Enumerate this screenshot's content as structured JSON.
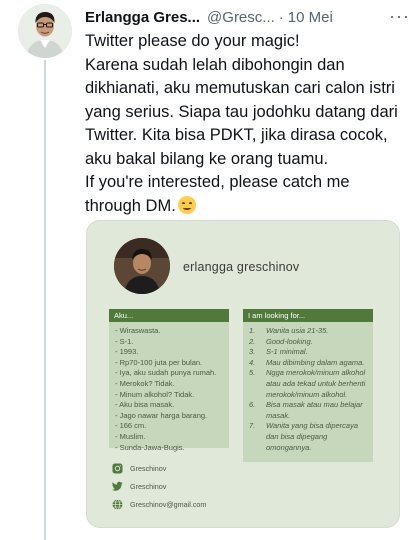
{
  "tweet": {
    "author_name": "Erlangga Gres...",
    "handle": "@Gresc...",
    "separator": "·",
    "time": "10 Mei",
    "more_icon": "more-icon",
    "text_lines": [
      "Twitter please do your magic!",
      "Karena sudah lelah dibohongin dan",
      "dikhianati, aku memutuskan cari calon istri",
      "yang serius. Siapa tau jodohku datang dari",
      "Twitter. Kita bisa PDKT, jika dirasa cocok,",
      "aku bakal bilang ke orang tuamu.",
      "If you're interested, please catch me",
      "through DM."
    ],
    "emoji": "smiling-face-emoji"
  },
  "card": {
    "name": "erlangga greschinov",
    "left_title": "Aku...",
    "left_items": [
      "- Wiraswasta.",
      "- S-1.",
      "- 1993.",
      "- Rp70-100 juta per bulan.",
      "- Iya, aku sudah punya rumah.",
      "- Merokok? Tidak.",
      "- Minum alkohol? Tidak.",
      "- Aku bisa masak.",
      "- Jago nawar harga barang.",
      "- 166 cm.",
      "- Muslim.",
      "- Sunda-Jawa-Bugis."
    ],
    "right_title": "I am looking for...",
    "right_items": [
      {
        "num": "1.",
        "text": "Wanita usia 21-35."
      },
      {
        "num": "2.",
        "text": "Good-looking."
      },
      {
        "num": "3.",
        "text": "S-1 minimal."
      },
      {
        "num": "4.",
        "text": "Mau dibimbing dalam agama."
      },
      {
        "num": "5.",
        "text": "Ngga merokok/minum alkohol atau ada tekad untuk berhenti merokok/minum alkohol."
      },
      {
        "num": "6.",
        "text": "Bisa masak atau mau belajar masak."
      },
      {
        "num": "7.",
        "text": "Wanita yang bisa dipercaya dan bisa dipegang omongannya."
      }
    ],
    "contacts": [
      {
        "icon": "instagram-icon",
        "text": "Greschinov"
      },
      {
        "icon": "twitter-icon",
        "text": "Greschinov"
      },
      {
        "icon": "whatsapp-icon",
        "text": "Greschinov@gmail.com"
      }
    ]
  },
  "colors": {
    "card_bg": "#dfe8d9",
    "header_green": "#4f7a3a",
    "body_green": "#c6d7bc",
    "icon_green": "#4f7a3a"
  }
}
